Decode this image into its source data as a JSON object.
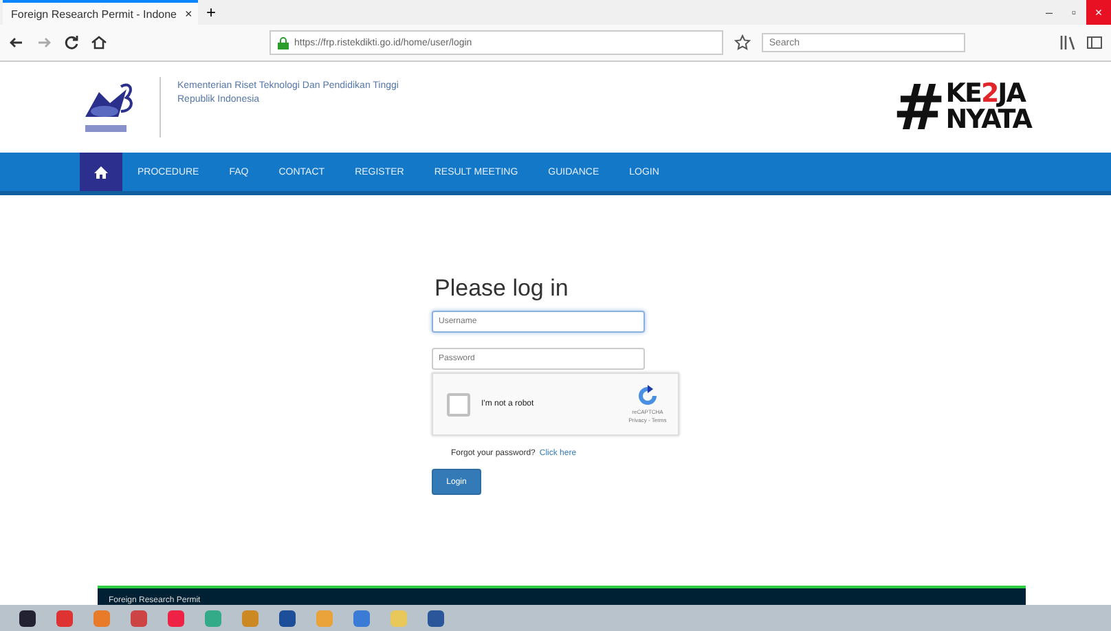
{
  "browser": {
    "tab": {
      "title": "Foreign Research Permit - Indone",
      "close": "×"
    },
    "new_tab": "+",
    "url": "https://frp.ristekdikti.go.id/home/user/login",
    "search": {
      "placeholder": "Search"
    },
    "window_controls": [
      "–",
      "▫",
      "×"
    ]
  },
  "header": {
    "ministry": "Kementerian Riset Teknologi Dan Pendidikan Tinggi",
    "country": "Republik Indonesia",
    "slogan": {
      "hash": "#",
      "lines": [
        [
          {
            "text": "KE",
            "color": "#111111"
          },
          {
            "text": "2",
            "color": "#e0262b"
          },
          {
            "text": "JA",
            "color": "#111111"
          }
        ],
        [
          {
            "text": "NYATA",
            "color": "#111111"
          }
        ]
      ]
    }
  },
  "nav": [
    {
      "kind": "home",
      "selected": true
    },
    {
      "label": "PROCEDURE",
      "selected": false
    },
    {
      "label": "FAQ",
      "selected": false
    },
    {
      "label": "CONTACT",
      "selected": false
    },
    {
      "label": "REGISTER",
      "selected": false
    },
    {
      "label": "RESULT MEETING",
      "selected": false
    },
    {
      "label": "GUIDANCE",
      "selected": false
    },
    {
      "label": "LOGIN",
      "selected": false
    }
  ],
  "login": {
    "title": "Please log in",
    "username": {
      "placeholder": "Username"
    },
    "password": {
      "placeholder": "Password"
    },
    "captcha": {
      "label": "I'm not a robot",
      "checked": false,
      "brand": "reCAPTCHA",
      "links": "Privacy - Terms"
    },
    "forgot": "Forgot your password?",
    "forgot_link": "Click here",
    "button": "Login"
  },
  "footer": {
    "text": "Foreign Research Permit"
  },
  "taskbar": [
    {
      "kind": "start"
    },
    {
      "kind": "red"
    },
    {
      "kind": "orange"
    },
    {
      "kind": "search"
    },
    {
      "kind": "firefox"
    },
    {
      "kind": "chrome"
    },
    {
      "kind": "media"
    },
    {
      "kind": "ps"
    },
    {
      "kind": "folder"
    },
    {
      "kind": "blue"
    },
    {
      "kind": "explorer"
    },
    {
      "kind": "word"
    }
  ]
}
